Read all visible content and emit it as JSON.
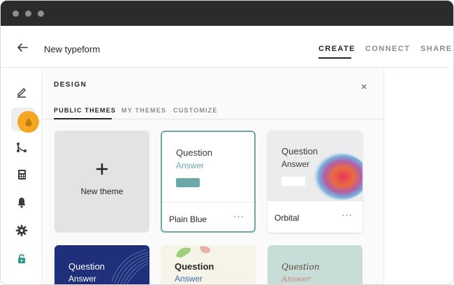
{
  "app": {
    "doc_title": "New typeform",
    "nav": [
      {
        "label": "CREATE",
        "active": true
      },
      {
        "label": "CONNECT",
        "active": false
      },
      {
        "label": "SHARE",
        "active": false
      }
    ]
  },
  "rail": {
    "items": [
      {
        "icon": "pencil-icon"
      },
      {
        "icon": "paint-drop-icon",
        "active": true
      },
      {
        "icon": "logic-branch-icon"
      },
      {
        "icon": "calculator-icon"
      },
      {
        "icon": "bell-icon"
      },
      {
        "icon": "gear-icon"
      },
      {
        "icon": "lock-icon",
        "color": "#2e9c8a"
      }
    ]
  },
  "design_panel": {
    "title": "DESIGN",
    "close_icon": "close-icon",
    "tabs": [
      {
        "label": "PUBLIC THEMES",
        "active": true
      },
      {
        "label": "MY THEMES",
        "active": false
      },
      {
        "label": "CUSTOMIZE",
        "active": false
      }
    ],
    "new_theme_label": "New theme",
    "themes": [
      {
        "name": "Plain Blue",
        "question": "Question",
        "answer": "Answer",
        "selected": true,
        "accent": "#6aa9a7",
        "more": "···"
      },
      {
        "name": "Orbital",
        "question": "Question",
        "answer": "Answer",
        "selected": false,
        "more": "···"
      },
      {
        "question": "Question",
        "answer": "Answer",
        "background": "#1f2f7a"
      },
      {
        "question": "Question",
        "answer": "Answer",
        "background": "#f6f3e8"
      },
      {
        "question": "Question",
        "answer": "Answer",
        "background": "#c8ddd7"
      }
    ]
  },
  "colors": {
    "accent_highlight": "#f5a623",
    "selected_border": "#6aa9a7"
  }
}
